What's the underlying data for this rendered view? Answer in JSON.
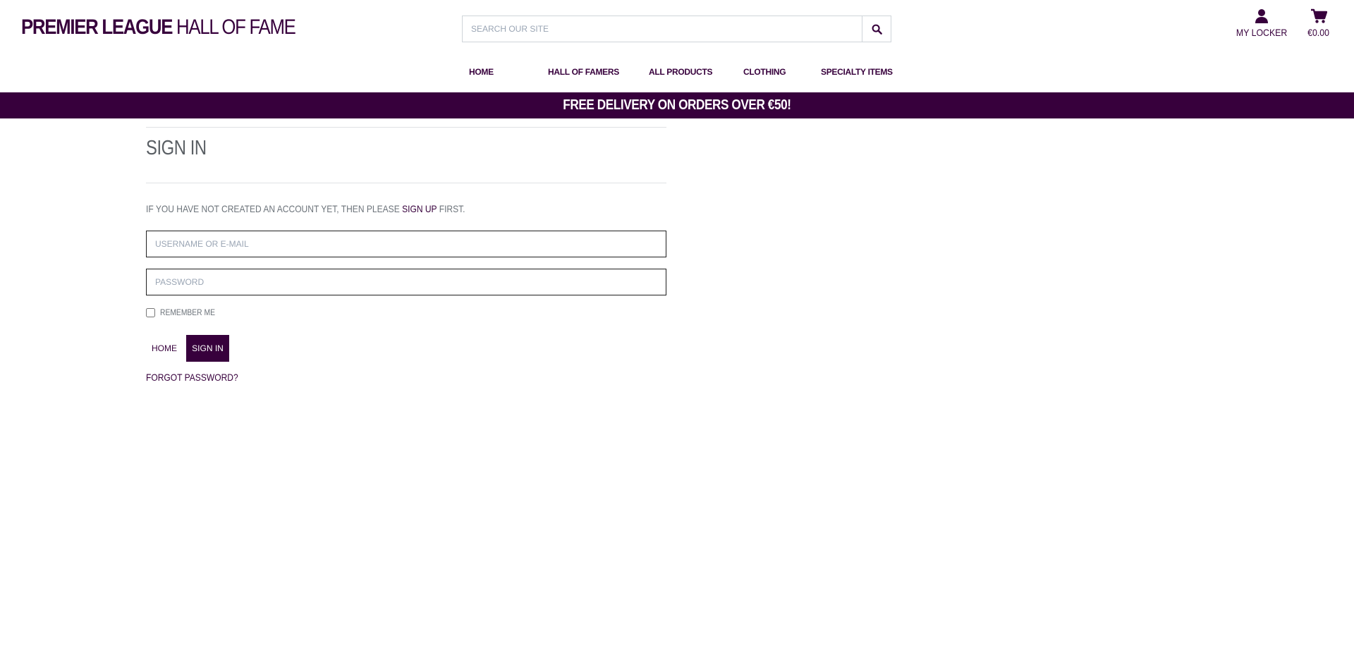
{
  "header": {
    "logo_bold": "Premier League",
    "logo_thin": "Hall of Fame",
    "search_placeholder": "Search our site",
    "search_icon": "search-icon",
    "account_label": "My Locker",
    "account_icon": "user-icon",
    "bag_total": "€0.00",
    "bag_icon": "shopping-cart-icon"
  },
  "nav": {
    "items": [
      {
        "label": "Home"
      },
      {
        "label": "Hall of Famers"
      },
      {
        "label": "All Products"
      },
      {
        "label": "Clothing"
      },
      {
        "label": "Specialty Items"
      }
    ]
  },
  "banner": {
    "text": "Free delivery on orders over €50!"
  },
  "signin": {
    "title": "Sign In",
    "intro_before": "If you have not created an account yet, then please",
    "intro_link": "sign up",
    "intro_after": "first.",
    "username_placeholder": "Username or e-mail",
    "password_placeholder": "Password",
    "remember_label": "Remember Me",
    "home_label": "Home",
    "submit_label": "Sign In",
    "forgot_label": "Forgot Password?"
  },
  "colors": {
    "brand": "#37003c",
    "text_muted": "#6c737a",
    "placeholder": "#9aa5b4"
  }
}
